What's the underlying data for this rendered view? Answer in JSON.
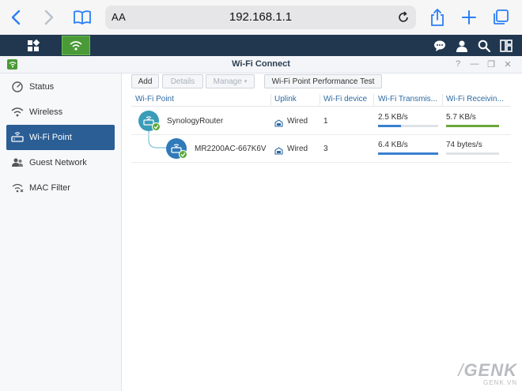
{
  "browser": {
    "url": "192.168.1.1",
    "text_size_label": "AA"
  },
  "window": {
    "title": "Wi-Fi Connect",
    "controls": [
      "?",
      "—",
      "❐",
      "✕"
    ]
  },
  "sidebar": {
    "items": [
      {
        "label": "Status",
        "icon": "status-gauge-icon",
        "active": false
      },
      {
        "label": "Wireless",
        "icon": "wifi-icon",
        "active": false
      },
      {
        "label": "Wi-Fi Point",
        "icon": "router-icon",
        "active": true
      },
      {
        "label": "Guest Network",
        "icon": "guest-users-icon",
        "active": false
      },
      {
        "label": "MAC Filter",
        "icon": "mac-filter-icon",
        "active": false
      }
    ]
  },
  "toolbar": {
    "add": "Add",
    "details": "Details",
    "manage": "Manage",
    "performance_test": "Wi-Fi Point Performance Test"
  },
  "table": {
    "columns": [
      "Wi-Fi Point",
      "Uplink",
      "Wi-Fi device",
      "Wi-Fi Transmis...",
      "Wi-Fi Receivin..."
    ],
    "rows": [
      {
        "name": "SynologyRouter",
        "uplink": "Wired",
        "devices": "1",
        "tx": "2.5 KB/s",
        "tx_level": 0.38,
        "rx": "5.7 KB/s",
        "rx_level": 1.0
      },
      {
        "name": "MR2200AC-667K6V",
        "uplink": "Wired",
        "devices": "3",
        "tx": "6.4 KB/s",
        "tx_level": 1.0,
        "rx": "74 bytes/s",
        "rx_level": 0.0
      }
    ]
  },
  "watermark": {
    "brand": "GENK",
    "site": "GENK.VN"
  },
  "colors": {
    "accent": "#2a7ff5",
    "taskbar": "#20374f",
    "active_item": "#2a5e95",
    "tx_bar": "#3a7fd0",
    "rx_bar": "#6aa83a",
    "node_primary": "#3a9cb8",
    "node_satellite": "#2f7ab8"
  }
}
